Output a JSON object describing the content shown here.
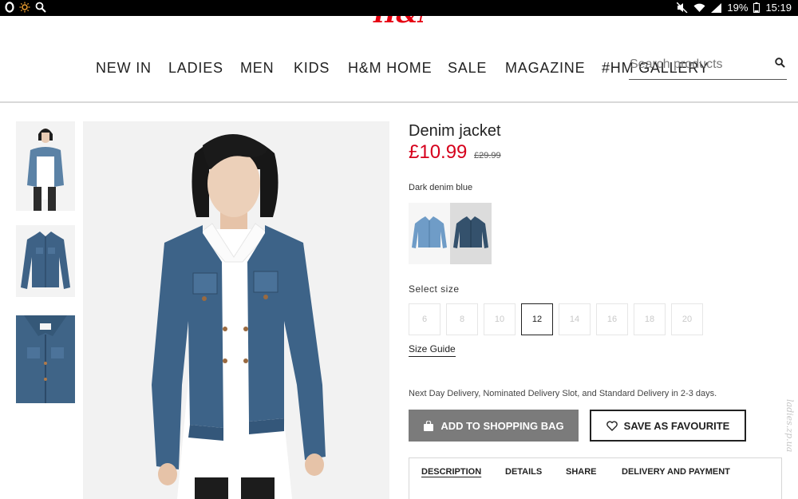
{
  "status_bar": {
    "battery": "19%",
    "time": "15:19",
    "icons": [
      "opera-icon",
      "brightness-icon",
      "search-icon",
      "mute-icon",
      "wifi-icon",
      "signal-icon",
      "battery-icon"
    ]
  },
  "brand": {
    "logo_text": "H&M",
    "color": "#e50010"
  },
  "nav": {
    "items": [
      "NEW IN",
      "LADIES",
      "MEN",
      "KIDS",
      "H&M HOME",
      "SALE",
      "MAGAZINE",
      "#HM GALLERY"
    ]
  },
  "search": {
    "placeholder": "Search products",
    "icon": "search-icon"
  },
  "product": {
    "title": "Denim jacket",
    "price": "£10.99",
    "old_price": "£29.99",
    "price_color": "#d6001c",
    "color_name": "Dark denim blue",
    "swatches": [
      {
        "name": "light denim",
        "color": "#6f9cc7",
        "selected": false
      },
      {
        "name": "dark denim",
        "color": "#34516c",
        "selected": true
      }
    ],
    "select_size_label": "Select size",
    "sizes": [
      "6",
      "8",
      "10",
      "12",
      "14",
      "16",
      "18",
      "20"
    ],
    "selected_size": "12",
    "size_guide_label": "Size Guide",
    "delivery_text": "Next Day Delivery, Nominated Delivery Slot, and Standard Delivery in 2-3 days."
  },
  "actions": {
    "add_to_bag_label": "ADD TO SHOPPING BAG",
    "add_to_bag_icon": "bag-icon",
    "favourite_label": "SAVE AS FAVOURITE",
    "favourite_icon": "heart-icon"
  },
  "info_tabs": {
    "tabs": [
      "DESCRIPTION",
      "DETAILS",
      "SHARE",
      "DELIVERY AND PAYMENT"
    ],
    "active": "DESCRIPTION"
  },
  "watermark": "ladies.zp.ua"
}
